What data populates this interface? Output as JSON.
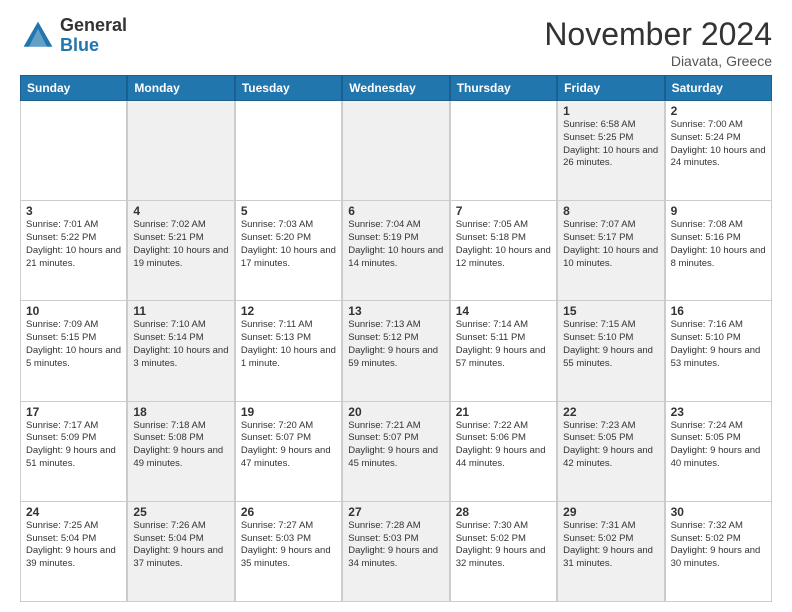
{
  "logo": {
    "general": "General",
    "blue": "Blue"
  },
  "header": {
    "title": "November 2024",
    "subtitle": "Diavata, Greece"
  },
  "weekdays": [
    "Sunday",
    "Monday",
    "Tuesday",
    "Wednesday",
    "Thursday",
    "Friday",
    "Saturday"
  ],
  "rows": [
    [
      {
        "day": "",
        "info": ""
      },
      {
        "day": "",
        "info": ""
      },
      {
        "day": "",
        "info": ""
      },
      {
        "day": "",
        "info": ""
      },
      {
        "day": "",
        "info": ""
      },
      {
        "day": "1",
        "info": "Sunrise: 6:58 AM\nSunset: 5:25 PM\nDaylight: 10 hours and 26 minutes."
      },
      {
        "day": "2",
        "info": "Sunrise: 7:00 AM\nSunset: 5:24 PM\nDaylight: 10 hours and 24 minutes."
      }
    ],
    [
      {
        "day": "3",
        "info": "Sunrise: 7:01 AM\nSunset: 5:22 PM\nDaylight: 10 hours and 21 minutes."
      },
      {
        "day": "4",
        "info": "Sunrise: 7:02 AM\nSunset: 5:21 PM\nDaylight: 10 hours and 19 minutes."
      },
      {
        "day": "5",
        "info": "Sunrise: 7:03 AM\nSunset: 5:20 PM\nDaylight: 10 hours and 17 minutes."
      },
      {
        "day": "6",
        "info": "Sunrise: 7:04 AM\nSunset: 5:19 PM\nDaylight: 10 hours and 14 minutes."
      },
      {
        "day": "7",
        "info": "Sunrise: 7:05 AM\nSunset: 5:18 PM\nDaylight: 10 hours and 12 minutes."
      },
      {
        "day": "8",
        "info": "Sunrise: 7:07 AM\nSunset: 5:17 PM\nDaylight: 10 hours and 10 minutes."
      },
      {
        "day": "9",
        "info": "Sunrise: 7:08 AM\nSunset: 5:16 PM\nDaylight: 10 hours and 8 minutes."
      }
    ],
    [
      {
        "day": "10",
        "info": "Sunrise: 7:09 AM\nSunset: 5:15 PM\nDaylight: 10 hours and 5 minutes."
      },
      {
        "day": "11",
        "info": "Sunrise: 7:10 AM\nSunset: 5:14 PM\nDaylight: 10 hours and 3 minutes."
      },
      {
        "day": "12",
        "info": "Sunrise: 7:11 AM\nSunset: 5:13 PM\nDaylight: 10 hours and 1 minute."
      },
      {
        "day": "13",
        "info": "Sunrise: 7:13 AM\nSunset: 5:12 PM\nDaylight: 9 hours and 59 minutes."
      },
      {
        "day": "14",
        "info": "Sunrise: 7:14 AM\nSunset: 5:11 PM\nDaylight: 9 hours and 57 minutes."
      },
      {
        "day": "15",
        "info": "Sunrise: 7:15 AM\nSunset: 5:10 PM\nDaylight: 9 hours and 55 minutes."
      },
      {
        "day": "16",
        "info": "Sunrise: 7:16 AM\nSunset: 5:10 PM\nDaylight: 9 hours and 53 minutes."
      }
    ],
    [
      {
        "day": "17",
        "info": "Sunrise: 7:17 AM\nSunset: 5:09 PM\nDaylight: 9 hours and 51 minutes."
      },
      {
        "day": "18",
        "info": "Sunrise: 7:18 AM\nSunset: 5:08 PM\nDaylight: 9 hours and 49 minutes."
      },
      {
        "day": "19",
        "info": "Sunrise: 7:20 AM\nSunset: 5:07 PM\nDaylight: 9 hours and 47 minutes."
      },
      {
        "day": "20",
        "info": "Sunrise: 7:21 AM\nSunset: 5:07 PM\nDaylight: 9 hours and 45 minutes."
      },
      {
        "day": "21",
        "info": "Sunrise: 7:22 AM\nSunset: 5:06 PM\nDaylight: 9 hours and 44 minutes."
      },
      {
        "day": "22",
        "info": "Sunrise: 7:23 AM\nSunset: 5:05 PM\nDaylight: 9 hours and 42 minutes."
      },
      {
        "day": "23",
        "info": "Sunrise: 7:24 AM\nSunset: 5:05 PM\nDaylight: 9 hours and 40 minutes."
      }
    ],
    [
      {
        "day": "24",
        "info": "Sunrise: 7:25 AM\nSunset: 5:04 PM\nDaylight: 9 hours and 39 minutes."
      },
      {
        "day": "25",
        "info": "Sunrise: 7:26 AM\nSunset: 5:04 PM\nDaylight: 9 hours and 37 minutes."
      },
      {
        "day": "26",
        "info": "Sunrise: 7:27 AM\nSunset: 5:03 PM\nDaylight: 9 hours and 35 minutes."
      },
      {
        "day": "27",
        "info": "Sunrise: 7:28 AM\nSunset: 5:03 PM\nDaylight: 9 hours and 34 minutes."
      },
      {
        "day": "28",
        "info": "Sunrise: 7:30 AM\nSunset: 5:02 PM\nDaylight: 9 hours and 32 minutes."
      },
      {
        "day": "29",
        "info": "Sunrise: 7:31 AM\nSunset: 5:02 PM\nDaylight: 9 hours and 31 minutes."
      },
      {
        "day": "30",
        "info": "Sunrise: 7:32 AM\nSunset: 5:02 PM\nDaylight: 9 hours and 30 minutes."
      }
    ]
  ]
}
